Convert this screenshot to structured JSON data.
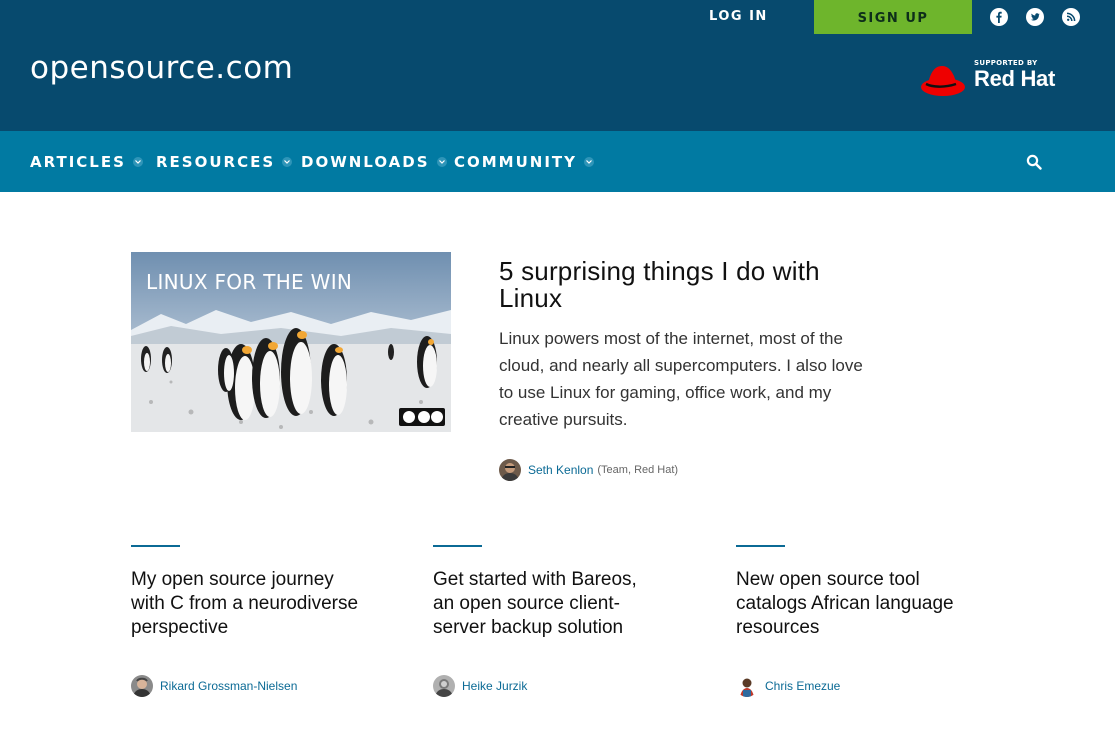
{
  "header": {
    "logo": "opensource.com",
    "login_label": "LOG IN",
    "signup_label": "SIGN UP",
    "social_icons": [
      "facebook-icon",
      "twitter-icon",
      "rss-icon"
    ],
    "supported_by": "SUPPORTED BY",
    "sponsor_name": "Red Hat"
  },
  "nav": {
    "items": [
      {
        "label": "ARTICLES"
      },
      {
        "label": "RESOURCES"
      },
      {
        "label": "DOWNLOADS"
      },
      {
        "label": "COMMUNITY"
      }
    ]
  },
  "featured": {
    "image_caption": "LINUX FOR THE WIN",
    "title": "5 surprising things I do with Linux",
    "description": "Linux powers most of the internet, most of the cloud, and nearly all supercomputers. I also love to use Linux for gaming, office work, and my creative pursuits.",
    "author": "Seth Kenlon",
    "author_meta": "(Team, Red Hat)"
  },
  "cards": [
    {
      "title": "My open source journey with C from a neurodiverse perspective",
      "author": "Rikard Grossman-Nielsen"
    },
    {
      "title": "Get started with Bareos, an open source client-server backup solution",
      "author": "Heike Jurzik"
    },
    {
      "title": "New open source tool catalogs African language resources",
      "author": "Chris Emezue"
    }
  ],
  "colors": {
    "header_bg": "#074a6e",
    "nav_bg": "#017aa2",
    "signup_bg": "#6eb52c",
    "link": "#0b6a95",
    "redhat": "#ee0000"
  }
}
